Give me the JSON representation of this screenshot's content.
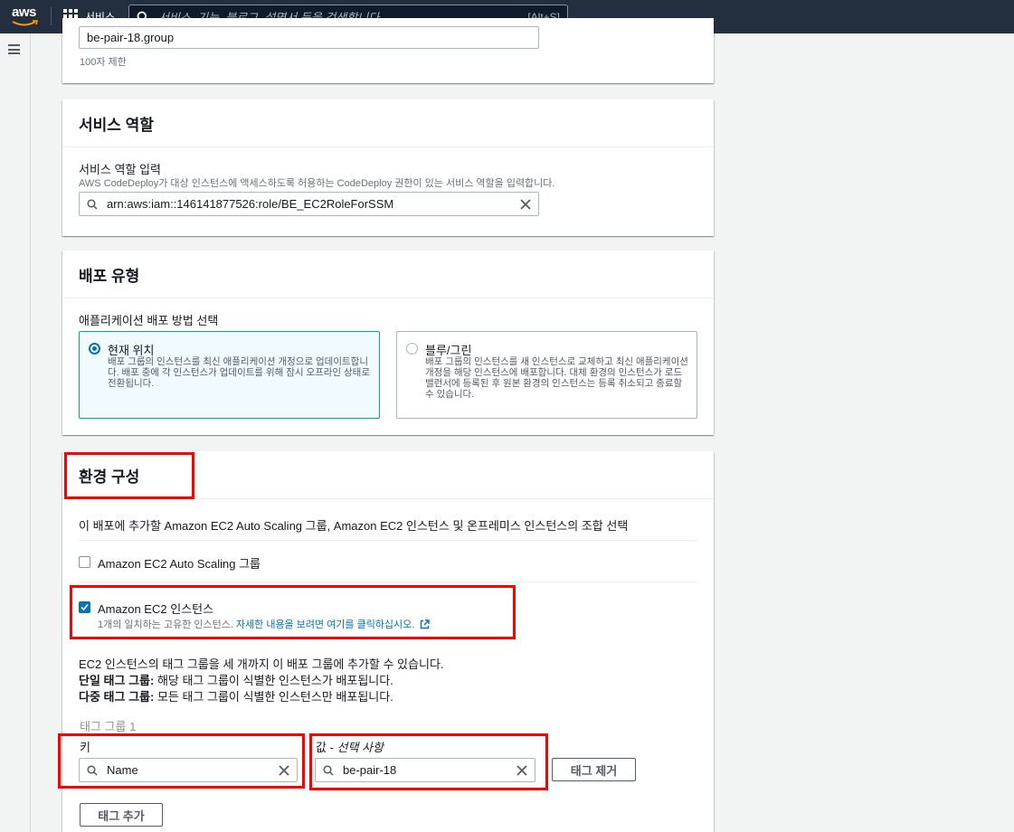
{
  "topnav": {
    "logo_text": "aws",
    "services_label": "서비스",
    "search_placeholder": "서비스, 기능, 블로그, 설명서 등을 검색합니다.",
    "search_shortcut": "[Alt+S]"
  },
  "group_name_section": {
    "value": "be-pair-18.group",
    "hint": "100자 제한"
  },
  "service_role": {
    "title": "서비스 역할",
    "label": "서비스 역할 입력",
    "description": "AWS CodeDeploy가 대상 인스턴스에 액세스하도록 허용하는 CodeDeploy 권한이 있는 서비스 역할을 입력합니다.",
    "value": "arn:aws:iam::146141877526:role/BE_EC2RoleForSSM"
  },
  "deployment_type": {
    "title": "배포 유형",
    "label": "애플리케이션 배포 방법 선택",
    "options": [
      {
        "label": "현재 위치",
        "description": "배포 그룹의 인스턴스를 최신 애플리케이션 개정으로 업데이트합니다. 배포 중에 각 인스턴스가 업데이트를 위해 잠시 오프라인 상태로 전환됩니다.",
        "selected": true
      },
      {
        "label": "블루/그린",
        "description": "배포 그룹의 인스턴스를 새 인스턴스로 교체하고 최신 애플리케이션 개정을 해당 인스턴스에 배포합니다. 대체 환경의 인스턴스가 로드 밸런서에 등록된 후 원본 환경의 인스턴스는 등록 취소되고 종료할 수 있습니다.",
        "selected": false
      }
    ]
  },
  "environment": {
    "title": "환경 구성",
    "description": "이 배포에 추가할 Amazon EC2 Auto Scaling 그룹, Amazon EC2 인스턴스 및 온프레미스 인스턴스의 조합 선택",
    "asg_label": "Amazon EC2 Auto Scaling 그룹",
    "asg_checked": false,
    "ec2_label": "Amazon EC2 인스턴스",
    "ec2_checked": true,
    "ec2_match_text": "1개의 일치하는 고유한 인스턴스.",
    "ec2_link_text": "자세한 내용을 보려면 여기를 클릭하십시오.",
    "tag_info_line1": "EC2 인스턴스의 태그 그룹을 세 개까지 이 배포 그룹에 추가할 수 있습니다.",
    "single_tag_bold": "단일 태그 그룹:",
    "single_tag_text": " 해당 태그 그룹이 식별한 인스턴스가 배포됩니다.",
    "multi_tag_bold": "다중 태그 그룹:",
    "multi_tag_text": " 모든 태그 그룹이 식별한 인스턴스만 배포됩니다.",
    "tag_group_title": "태그 그룹 1",
    "key_label": "키",
    "key_value": "Name",
    "value_label_prefix": "값 - ",
    "value_label_optional": "선택 사항",
    "value_value": "be-pair-18",
    "remove_tag_button": "태그 제거",
    "add_tag_button": "태그 추가"
  },
  "colors": {
    "nav_bg": "#232f3e",
    "accent": "#0073bb",
    "highlight": "#ff0000"
  }
}
